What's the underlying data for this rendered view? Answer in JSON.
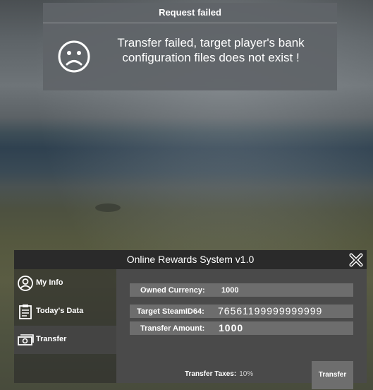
{
  "notification": {
    "title": "Request failed",
    "message": "Transfer failed, target player's bank configuration files does not exist !",
    "icon": "sad-face-icon"
  },
  "window": {
    "title": "Online Rewards System v1.0",
    "close_icon": "close-x-icon"
  },
  "sidebar": {
    "items": [
      {
        "label": "My Info",
        "icon": "user-circle-icon",
        "active": false
      },
      {
        "label": "Today's Data",
        "icon": "clipboard-icon",
        "active": false
      },
      {
        "label": "Transfer",
        "icon": "money-icon",
        "active": true
      }
    ]
  },
  "transfer": {
    "owned_currency_label": "Owned Currency:",
    "owned_currency_value": "1000",
    "target_label": "Target SteamID64:",
    "target_value": "76561199999999999",
    "amount_label": "Transfer Amount:",
    "amount_value": "1000",
    "taxes_label": "Transfer Taxes:",
    "taxes_value": "10%",
    "button_label": "Transfer"
  }
}
